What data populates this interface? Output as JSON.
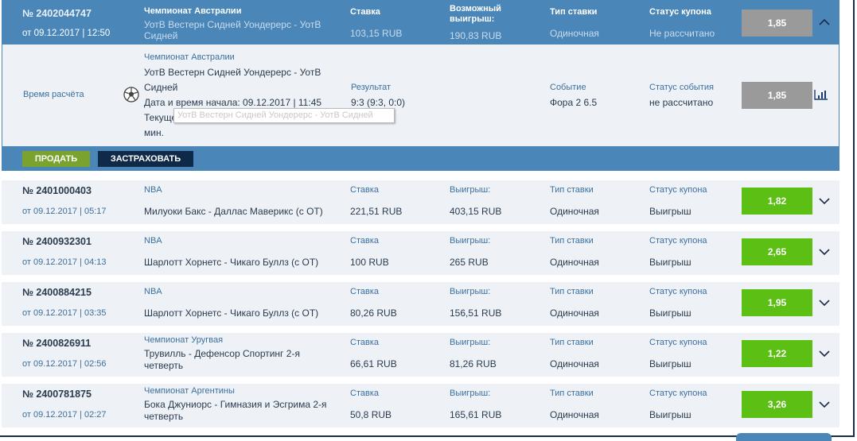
{
  "active": {
    "number": "№ 2402044747",
    "date": "от 09.12.2017 | 12:50",
    "league": "Чемпионат Австралии",
    "event_line1": "УотВ Вестерн Сидней Уондерерс - УотВ",
    "event_line2": "Сидней",
    "stake_label": "Ставка",
    "stake": "103,15 RUB",
    "win_label_1": "Возможный",
    "win_label_2": "выигрыш:",
    "win": "190,83 RUB",
    "type_label": "Тип ставки",
    "type": "Одиночная",
    "status_label": "Статус купона",
    "status": "Не рассчитано",
    "odds": "1,85"
  },
  "detail": {
    "calc_time_label": "Время расчёта",
    "league": "Чемпионат Австралии",
    "event_line1": "УотВ Вестерн Сидней Уондерерс - УотВ",
    "event_line2": "Сидней",
    "start": "Дата и время начала: 09.12.2017 | 11:45",
    "state_line1": "Текущее состояние: Идёт игра. Прошло 45",
    "state_line2": "мин.",
    "tooltip": "УотВ Вестерн Сидней Уондерерс - УотВ Сидней",
    "result_label": "Результат",
    "result": "9:3 (9:3, 0:0)",
    "event_label": "Событие",
    "event": "Фора 2 6.5",
    "event_status_label": "Статус события",
    "event_status": "не рассчитано",
    "odds": "1,85"
  },
  "buttons": {
    "sell": "ПРОДАТЬ",
    "insure": "ЗАСТРАХОВАТЬ"
  },
  "colors": {
    "blue": "#4a86b8",
    "green": "#5cbf14",
    "grey": "#9a9a9a",
    "sell": "#7aa22e",
    "insure": "#0f2a48"
  },
  "rows": [
    {
      "number": "№ 2401000403",
      "date": "от 09.12.2017 | 05:17",
      "league": "NBA",
      "event1": "Милуоки Бакс - Даллас Маверикс (с ОТ)",
      "event2": "",
      "stake_label": "Ставка",
      "stake": "221,51 RUB",
      "win_label": "Выигрыш:",
      "win": "403,15 RUB",
      "type_label": "Тип ставки",
      "type": "Одиночная",
      "status_label": "Статус купона",
      "status": "Выигрыш",
      "odds": "1,82"
    },
    {
      "number": "№ 2400932301",
      "date": "от 09.12.2017 | 04:13",
      "league": "NBA",
      "event1": "Шарлотт Хорнетс - Чикаго Буллз (с ОТ)",
      "event2": "",
      "stake_label": "Ставка",
      "stake": "100 RUB",
      "win_label": "Выигрыш:",
      "win": "265 RUB",
      "type_label": "Тип ставки",
      "type": "Одиночная",
      "status_label": "Статус купона",
      "status": "Выигрыш",
      "odds": "2,65"
    },
    {
      "number": "№ 2400884215",
      "date": "от 09.12.2017 | 03:35",
      "league": "NBA",
      "event1": "Шарлотт Хорнетс - Чикаго Буллз (с ОТ)",
      "event2": "",
      "stake_label": "Ставка",
      "stake": "80,26 RUB",
      "win_label": "Выигрыш:",
      "win": "156,51 RUB",
      "type_label": "Тип ставки",
      "type": "Одиночная",
      "status_label": "Статус купона",
      "status": "Выигрыш",
      "odds": "1,95"
    },
    {
      "number": "№ 2400826911",
      "date": "от 09.12.2017 | 02:56",
      "league": "Чемпионат Уругвая",
      "event1": "Трувилль - Дефенсор Спортинг 2-я",
      "event2": "четверть",
      "stake_label": "Ставка",
      "stake": "66,61 RUB",
      "win_label": "Выигрыш:",
      "win": "81,26 RUB",
      "type_label": "Тип ставки",
      "type": "Одиночная",
      "status_label": "Статус купона",
      "status": "Выигрыш",
      "odds": "1,22"
    },
    {
      "number": "№ 2400781875",
      "date": "от 09.12.2017 | 02:27",
      "league": "Чемпионат Аргентины",
      "event1": "Бока Джуниорс - Гимназия и Эсгрима 2-я",
      "event2": "четверть",
      "stake_label": "Ставка",
      "stake": "50,8 RUB",
      "win_label": "Выигрыш:",
      "win": "165,61 RUB",
      "type_label": "Тип ставки",
      "type": "Одиночная",
      "status_label": "Статус купона",
      "status": "Выигрыш",
      "odds": "3,26"
    }
  ]
}
